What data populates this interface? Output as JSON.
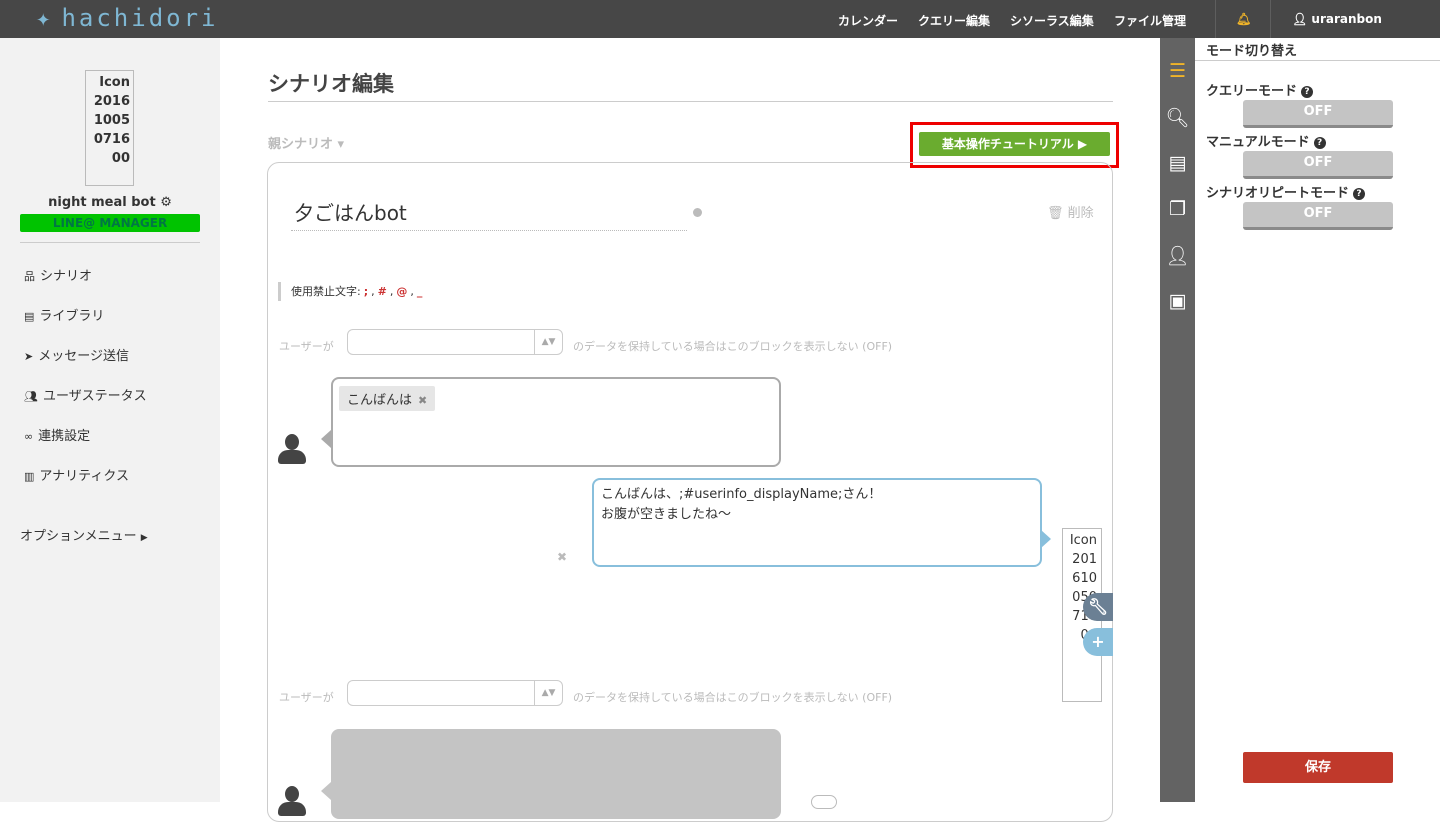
{
  "header": {
    "logo": "hachidori",
    "nav": [
      "カレンダー",
      "クエリー編集",
      "シソーラス編集",
      "ファイル管理"
    ],
    "bell_icon": "bell-icon",
    "user": "uraranbon"
  },
  "sidebar": {
    "avatar_alt": "Icon 20161005071600",
    "bot_name": "night meal bot",
    "badge": "LINE@ MANAGER",
    "items": [
      {
        "icon": "sitemap-icon",
        "label": "シナリオ"
      },
      {
        "icon": "book-icon",
        "label": "ライブラリ"
      },
      {
        "icon": "paper-plane-icon",
        "label": "メッセージ送信"
      },
      {
        "icon": "users-icon",
        "label": "ユーザステータス"
      },
      {
        "icon": "link-icon",
        "label": "連携設定"
      },
      {
        "icon": "bar-chart-icon",
        "label": "アナリティクス"
      }
    ],
    "options": "オプションメニュー"
  },
  "main": {
    "title": "シナリオ編集",
    "parent": "親シナリオ",
    "tutorial": "基本操作チュートリアル ▶",
    "scenario_name": "夕ごはんbot",
    "delete": "削除",
    "forbidden_label": "使用禁止文字:",
    "forbidden_chars": [
      ";",
      "#",
      "@",
      "_"
    ],
    "cond_prefix": "ユーザーが",
    "cond_suffix": "のデータを保持している場合はこのブロックを表示しない (OFF)",
    "user_tag": "こんばんは",
    "bot_message_lines": [
      "こんばんは、;#userinfo_displayName;さん！",
      "お腹が空きましたね〜"
    ],
    "bot_icon_alt": "Icon 20161005071600"
  },
  "right_panel": {
    "title": "モード切り替え",
    "modes": [
      {
        "label": "クエリーモード",
        "state": "OFF"
      },
      {
        "label": "マニュアルモード",
        "state": "OFF"
      },
      {
        "label": "シナリオリピートモード",
        "state": "OFF"
      }
    ],
    "save": "保存"
  },
  "colors": {
    "topbar": "#474747",
    "accent_green": "#6aac2f",
    "line_green": "#00c300",
    "save_red": "#c0392b",
    "bubble_blue": "#88bfdc"
  }
}
